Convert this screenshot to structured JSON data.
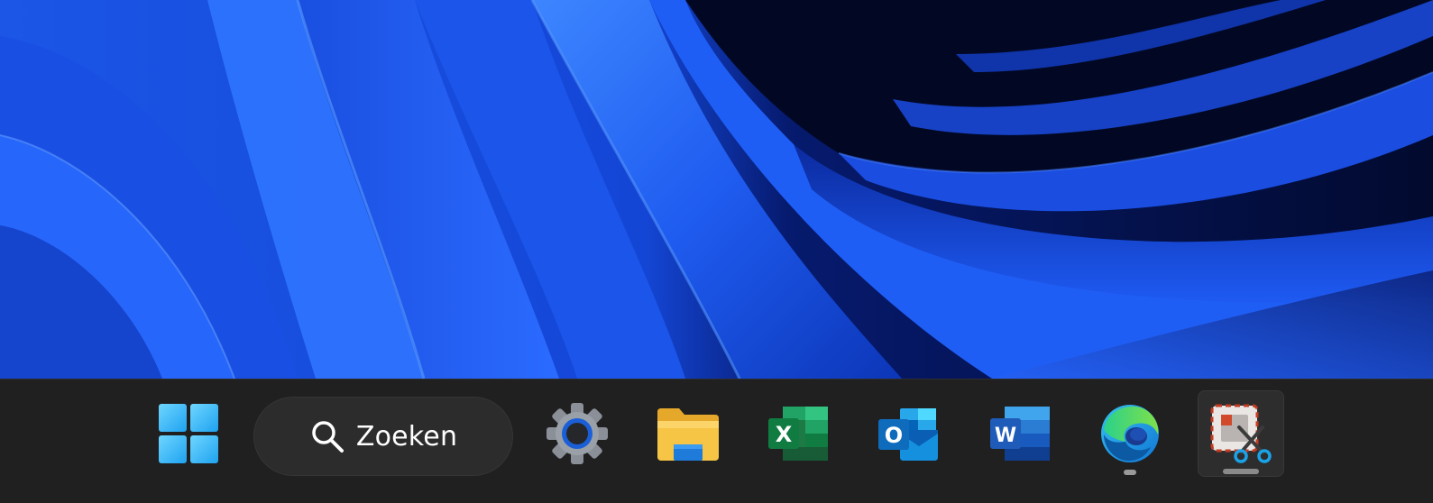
{
  "colors": {
    "taskbar": "#202020",
    "search_box": "#2c2c2c",
    "wallpaper_blue": "#1f5cf0",
    "wallpaper_dark": "#020a2e",
    "excel_green": "#1d7a45",
    "word_blue": "#1f5bb8",
    "outlook_blue": "#0f6cbd",
    "folder_yellow": "#f7c545"
  },
  "desktop": {
    "wallpaper": "windows-11-bloom-blue"
  },
  "taskbar": {
    "start": {
      "icon": "windows-start-icon"
    },
    "search": {
      "icon": "search-icon",
      "label": "Zoeken"
    },
    "apps": [
      {
        "id": "settings",
        "icon": "settings-gear-icon",
        "running": false
      },
      {
        "id": "file-explorer",
        "icon": "folder-icon",
        "running": false
      },
      {
        "id": "excel",
        "icon": "excel-icon",
        "letter": "X",
        "running": false
      },
      {
        "id": "outlook",
        "icon": "outlook-icon",
        "letter": "O",
        "running": false
      },
      {
        "id": "word",
        "icon": "word-icon",
        "letter": "W",
        "running": false
      },
      {
        "id": "edge",
        "icon": "edge-icon",
        "running": true
      },
      {
        "id": "snipping-tool",
        "icon": "snipping-tool-icon",
        "running": true,
        "active": true
      }
    ]
  }
}
